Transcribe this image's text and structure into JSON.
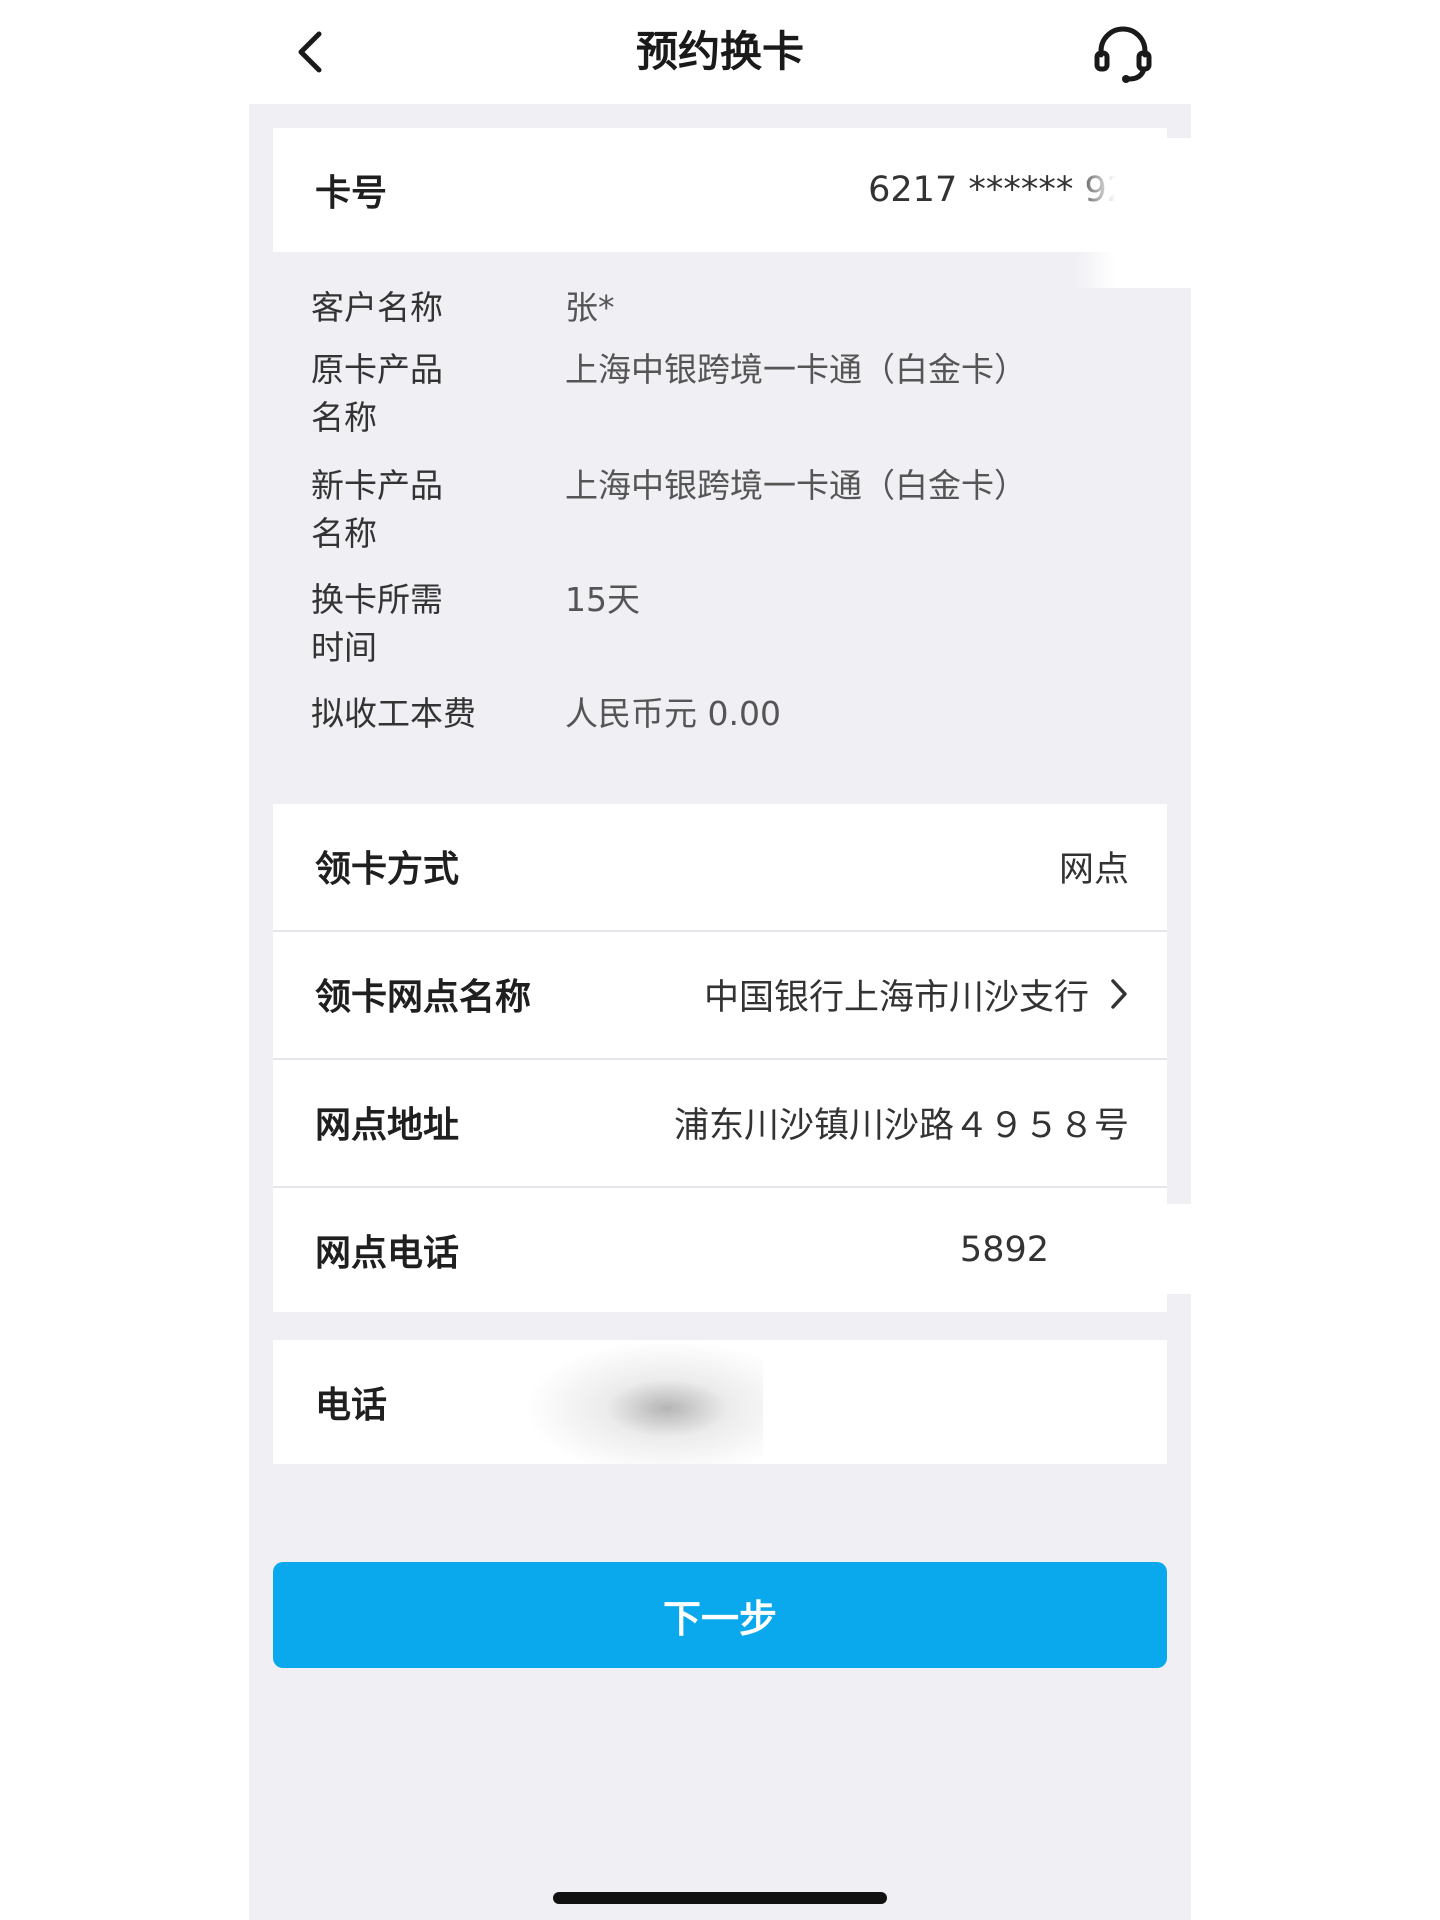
{
  "header": {
    "title": "预约换卡",
    "back_icon": "chevron-left-icon",
    "service_icon": "headset-icon"
  },
  "card_number": {
    "label": "卡号",
    "value": "6217 ****** 92"
  },
  "details": [
    {
      "label": "客户名称",
      "value": "张*"
    },
    {
      "label": "原卡产品\n名称",
      "value": "上海中银跨境一卡通（白金卡）"
    },
    {
      "label": "新卡产品\n名称",
      "value": "上海中银跨境一卡通（白金卡）"
    },
    {
      "label": "换卡所需\n时间",
      "value": "15天"
    },
    {
      "label": "拟收工本费",
      "value": "人民币元 0.00"
    }
  ],
  "pickup": {
    "method_label": "领卡方式",
    "method_value": "网点",
    "branch_label": "领卡网点名称",
    "branch_value": "中国银行上海市川沙支行",
    "address_label": "网点地址",
    "address_value": "浦东川沙镇川沙路４９５８号",
    "phone_label": "网点电话",
    "phone_value": "5892"
  },
  "contact": {
    "phone_label": "电话",
    "phone_value": ""
  },
  "next_button": {
    "label": "下一步"
  },
  "colors": {
    "accent": "#0aa8ec",
    "background": "#efeff4",
    "card": "#ffffff"
  }
}
